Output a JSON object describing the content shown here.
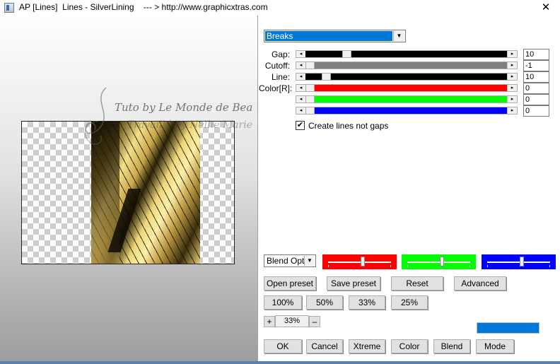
{
  "window": {
    "title": "AP [Lines]  Lines - SilverLining    --- > http://www.graphicxtras.com",
    "close_glyph": "✕"
  },
  "watermark": {
    "line1": "Tuto by Le Monde de Bea",
    "line2": "Travaillé by Nellie Marie"
  },
  "effect_dropdown": {
    "selected": "Breaks"
  },
  "controls": [
    {
      "label": "Gap:",
      "value": "10",
      "position": 0.1921,
      "fill": "#000000"
    },
    {
      "label": "Cutoff:",
      "value": "-1",
      "position": 0.0,
      "fill": "#808080"
    },
    {
      "label": "Line:",
      "value": "10",
      "position": 0.0854,
      "fill": "#000000"
    },
    {
      "label": "Color[R]:",
      "value": "0",
      "position": 0.0,
      "fill": "#ff0000"
    },
    {
      "label": "",
      "value": "0",
      "position": 0.0,
      "fill": "#00ff00"
    },
    {
      "label": "",
      "value": "0",
      "position": 0.0,
      "fill": "#0000ff"
    }
  ],
  "checkbox": {
    "label": "Create lines not gaps",
    "checked": true,
    "glyph": "✔"
  },
  "blend": {
    "dropdown_text": "Blend Options"
  },
  "color_sliders": [
    {
      "color": "#ff0000",
      "position": 0.55
    },
    {
      "color": "#00ff00",
      "position": 0.55
    },
    {
      "color": "#0000ff",
      "position": 0.55
    }
  ],
  "preset_buttons": {
    "open": "Open preset",
    "save": "Save preset",
    "reset": "Reset",
    "advanced": "Advanced"
  },
  "zoom_buttons": [
    "100%",
    "50%",
    "33%",
    "25%"
  ],
  "zoom": {
    "plus": "+",
    "value": "33%",
    "minus": "–"
  },
  "action_buttons": [
    "OK",
    "Cancel",
    "Xtreme",
    "Color",
    "Blend",
    "Mode"
  ],
  "accent_color": "#0078d7"
}
